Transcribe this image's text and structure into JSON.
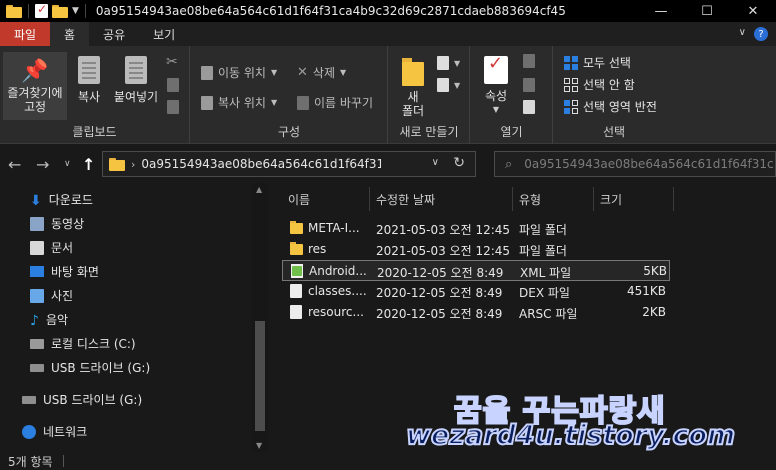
{
  "window": {
    "title": "0a95154943ae08be64a564c61d1f64f31ca4b9c32d69c2871cdaeb883694cf45",
    "controls": {
      "minimize": "—",
      "maximize": "☐",
      "close": "✕"
    }
  },
  "tabs": [
    {
      "label": "파일"
    },
    {
      "label": "홈"
    },
    {
      "label": "공유"
    },
    {
      "label": "보기"
    }
  ],
  "ribbon": {
    "clipboard": {
      "label": "클립보드",
      "pin": "즐겨찾기에\n고정",
      "copy": "복사",
      "paste": "붙여넣기"
    },
    "organize": {
      "label": "구성",
      "move_to": "이동 위치",
      "copy_to": "복사 위치",
      "delete": "삭제",
      "rename": "이름 바꾸기"
    },
    "new": {
      "label": "새로 만들기",
      "new_folder": "새\n폴더"
    },
    "open": {
      "label": "열기",
      "properties": "속성"
    },
    "select": {
      "label": "선택",
      "select_all": "모두 선택",
      "select_none": "선택 안 함",
      "invert": "선택 영역 반전"
    }
  },
  "address": {
    "path": "0a95154943ae08be64a564c61d1f64f31c...",
    "search_placeholder": "0a95154943ae08be64a564c61d1f64f31c..."
  },
  "nav": {
    "items": [
      {
        "label": "다운로드",
        "icon": "download-icon"
      },
      {
        "label": "동영상",
        "icon": "video-icon"
      },
      {
        "label": "문서",
        "icon": "document-icon"
      },
      {
        "label": "바탕 화면",
        "icon": "desktop-icon"
      },
      {
        "label": "사진",
        "icon": "pictures-icon"
      },
      {
        "label": "음악",
        "icon": "music-icon"
      },
      {
        "label": "로컬 디스크 (C:)",
        "icon": "local-disk-icon"
      },
      {
        "label": "USB 드라이브 (G:)",
        "icon": "usb-drive-icon"
      },
      {
        "label": "USB 드라이브 (G:)",
        "icon": "usb-drive-icon"
      },
      {
        "label": "네트워크",
        "icon": "network-icon"
      }
    ]
  },
  "columns": {
    "name": "이름",
    "modified": "수정한 날짜",
    "type": "유형",
    "size": "크기"
  },
  "files": [
    {
      "name": "META-I...",
      "modified": "2021-05-03 오전 12:45",
      "type": "파일 폴더",
      "size": ""
    },
    {
      "name": "res",
      "modified": "2021-05-03 오전 12:45",
      "type": "파일 폴더",
      "size": ""
    },
    {
      "name": "Android...",
      "modified": "2020-12-05 오전 8:49",
      "type": "XML 파일",
      "size": "5KB"
    },
    {
      "name": "classes....",
      "modified": "2020-12-05 오전 8:49",
      "type": "DEX 파일",
      "size": "451KB"
    },
    {
      "name": "resourc...",
      "modified": "2020-12-05 오전 8:49",
      "type": "ARSC 파일",
      "size": "2KB"
    }
  ],
  "status": {
    "count": "5개 항목"
  },
  "watermark": {
    "line1": "꿈을 꾸는파랑새",
    "line2": "wezard4u.tistory.com"
  }
}
